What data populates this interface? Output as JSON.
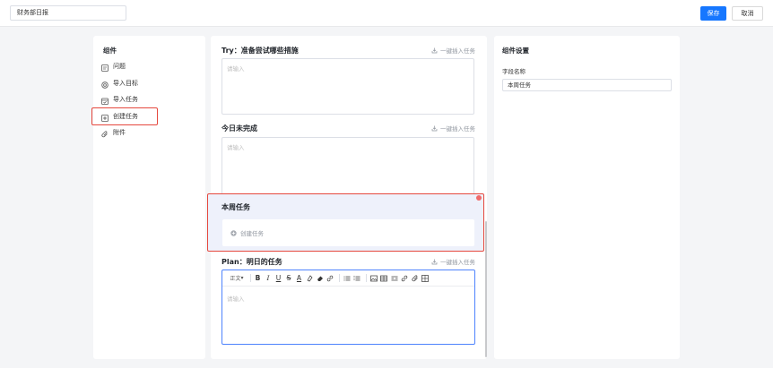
{
  "header": {
    "report_title": "财务部日报",
    "save_label": "保存",
    "cancel_label": "取消",
    "primary_color": "#1677ff"
  },
  "components": {
    "title": "组件",
    "items": [
      {
        "label": "问题",
        "icon": "question-icon"
      },
      {
        "label": "导入目标",
        "icon": "target-icon"
      },
      {
        "label": "导入任务",
        "icon": "calendar-icon"
      },
      {
        "label": "创建任务",
        "icon": "plus-square-icon",
        "active": true
      },
      {
        "label": "附件",
        "icon": "paperclip-icon"
      }
    ]
  },
  "form": {
    "one_click_insert": "一键插入任务",
    "placeholder": "请输入",
    "sections": [
      {
        "title": "Try：准备尝试哪些措施"
      },
      {
        "title": "今日未完成"
      }
    ],
    "selected_block": {
      "title": "本周任务",
      "create_label": "创建任务",
      "highlight_color": "#e5483e"
    },
    "plan": {
      "title": "Plan：明日的任务",
      "toolbar_style": "正文"
    }
  },
  "settings": {
    "title": "组件设置",
    "field_label": "字段名称",
    "field_value": "本周任务"
  }
}
